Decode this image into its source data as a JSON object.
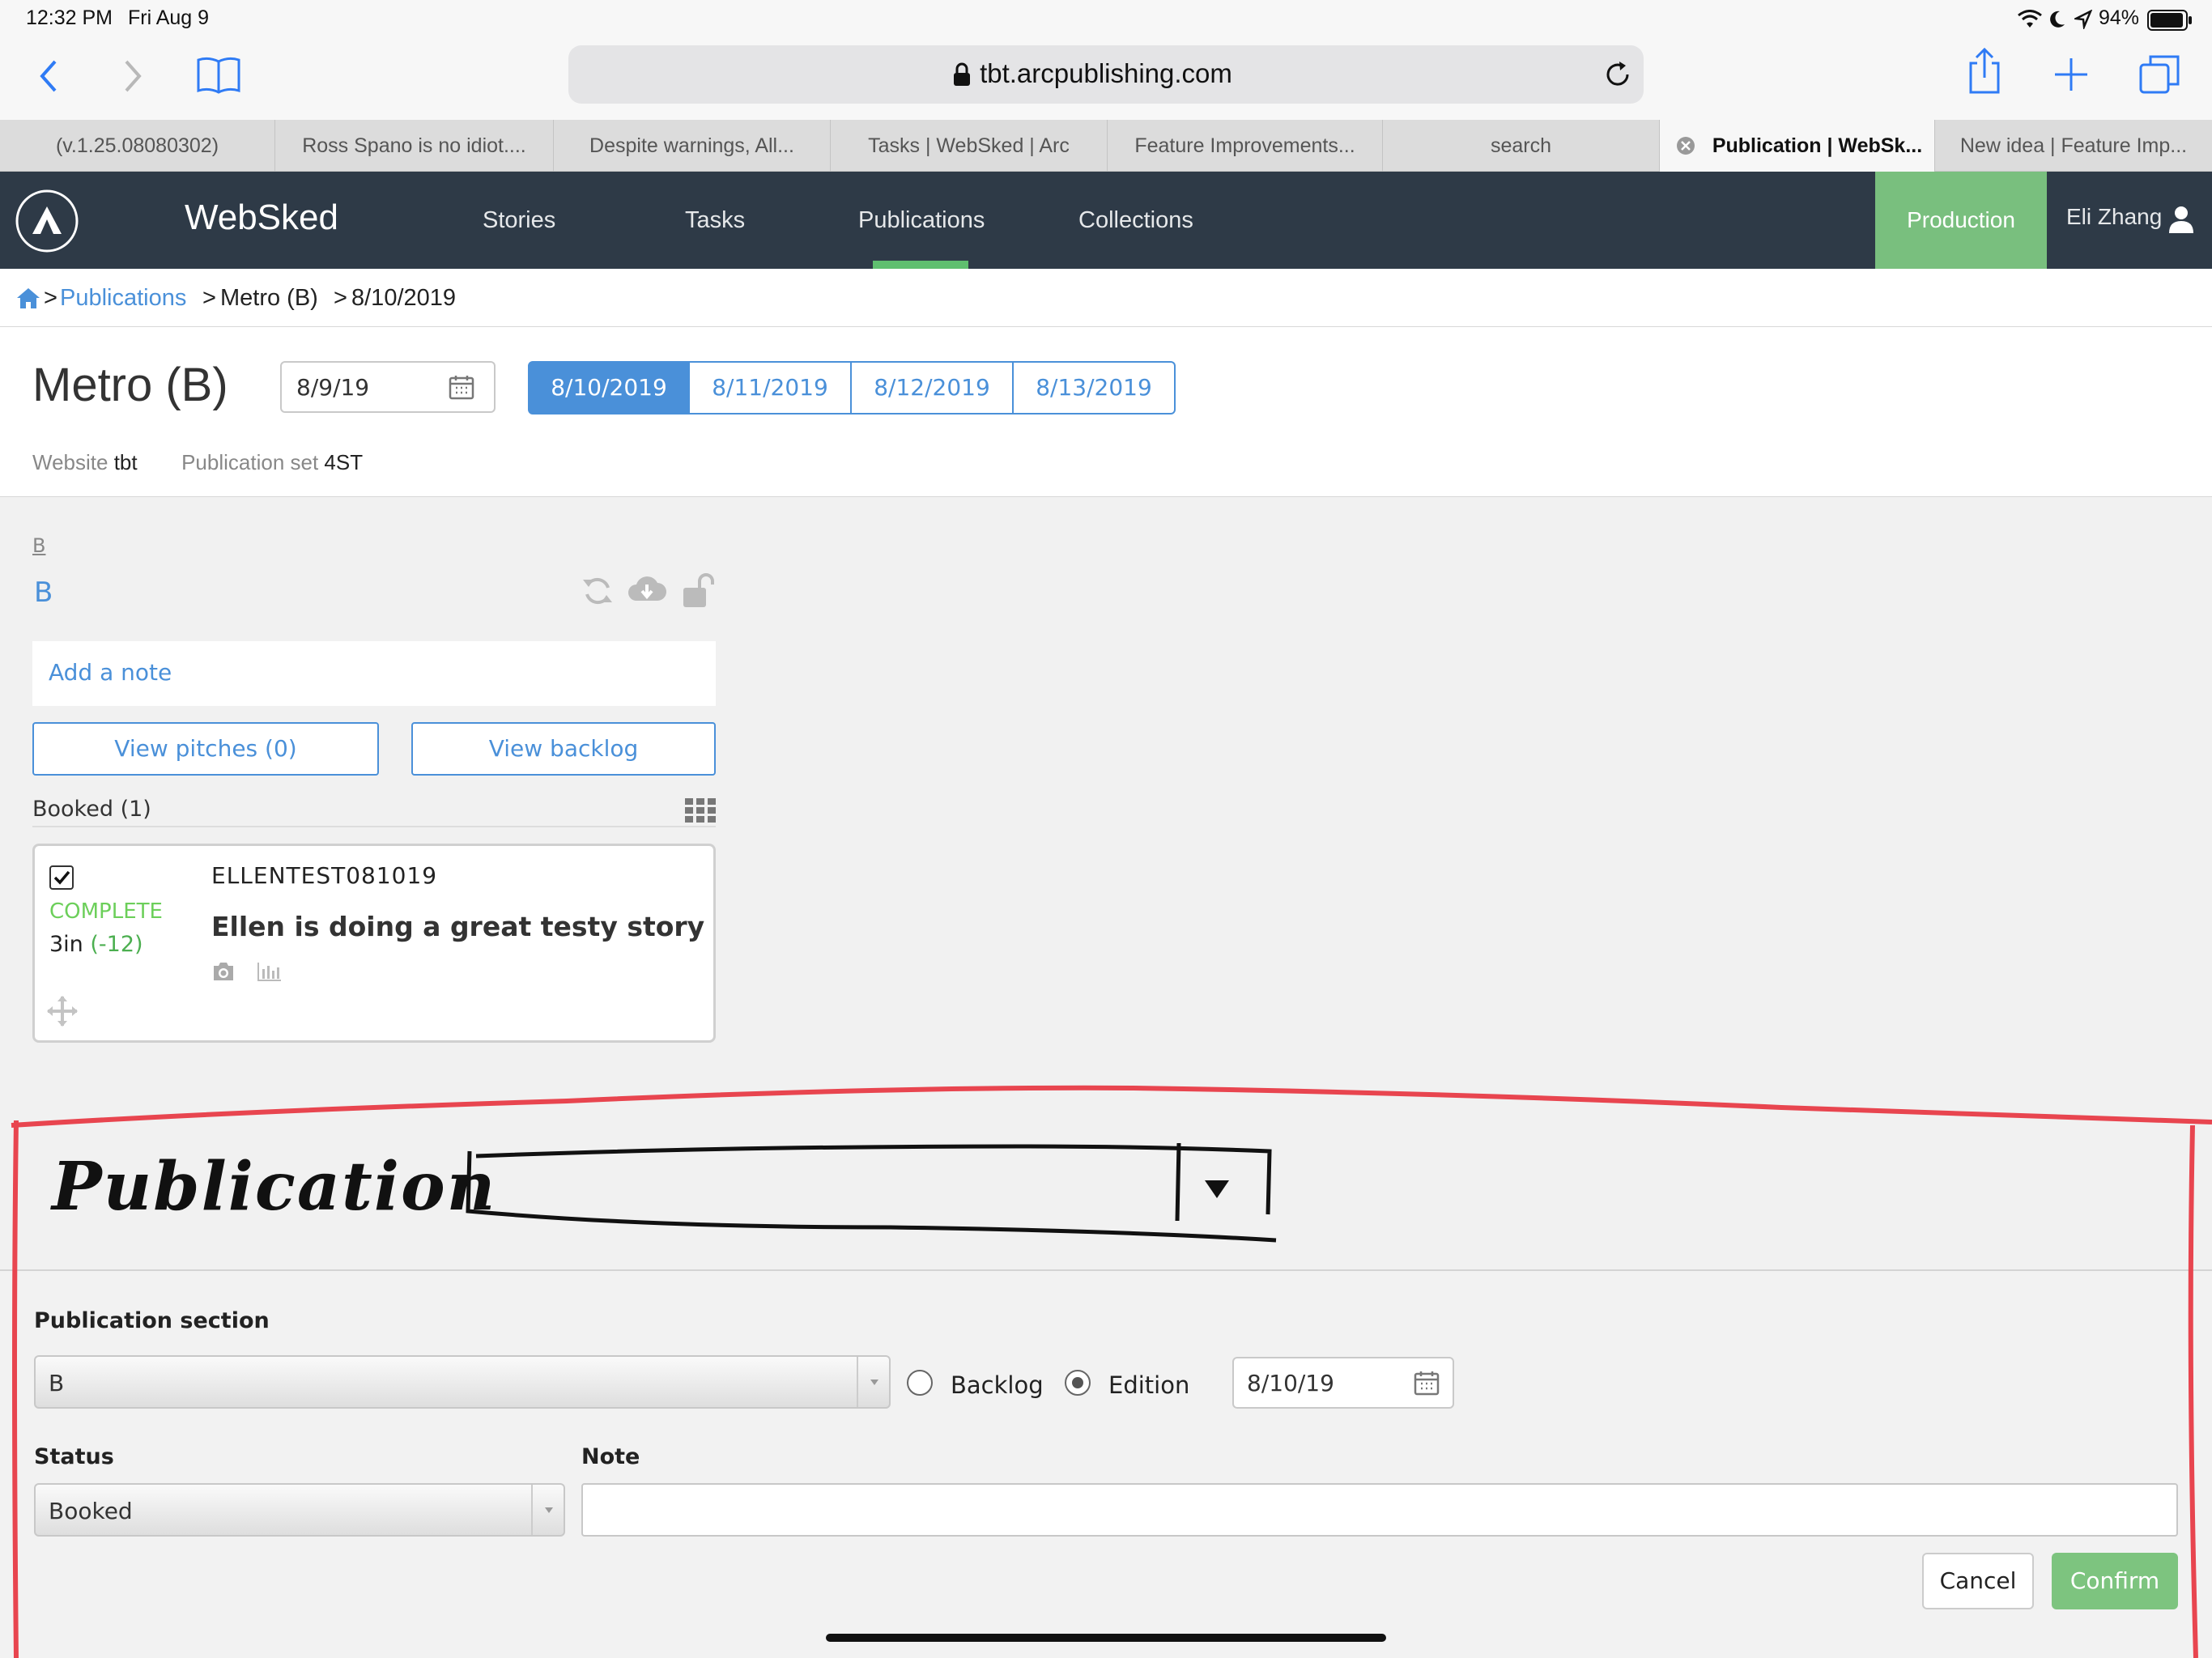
{
  "status_bar": {
    "time": "12:32 PM",
    "date": "Fri Aug 9",
    "battery": "94%"
  },
  "browser": {
    "url": "tbt.arcpublishing.com",
    "tabs": [
      "(v.1.25.08080302)",
      "Ross Spano is no idiot....",
      "Despite warnings, All...",
      "Tasks | WebSked | Arc",
      "Feature Improvements...",
      "search",
      "Publication | WebSk...",
      "New idea | Feature Imp..."
    ]
  },
  "app": {
    "brand": "WebSked",
    "nav": [
      "Stories",
      "Tasks",
      "Publications",
      "Collections"
    ],
    "environment": "Production",
    "user": "Eli Zhang"
  },
  "breadcrumb": {
    "publications": "Publications",
    "publication": "Metro (B)",
    "date": "8/10/2019"
  },
  "header": {
    "title": "Metro (B)",
    "date_input": "8/9/19",
    "date_tabs": [
      "8/10/2019",
      "8/11/2019",
      "8/12/2019",
      "8/13/2019"
    ],
    "website_label": "Website",
    "website_value": "tbt",
    "pubset_label": "Publication set",
    "pubset_value": "4ST"
  },
  "section": {
    "small_link": "B",
    "name": "B",
    "add_note": "Add a note",
    "view_pitches": "View pitches  (0)",
    "view_backlog": "View backlog",
    "booked_label": "Booked (1)"
  },
  "story": {
    "slug": "ELLENTEST081019",
    "status": "COMPLETE",
    "size": "3in",
    "size_delta": "(-12)",
    "title": "Ellen is doing a great testy story"
  },
  "annotation": {
    "handwritten_label": "Publication"
  },
  "form": {
    "section_label": "Publication section",
    "section_value": "B",
    "backlog_label": "Backlog",
    "edition_label": "Edition",
    "edition_date": "8/10/19",
    "status_label": "Status",
    "status_value": "Booked",
    "note_label": "Note",
    "note_value": "",
    "cancel": "Cancel",
    "confirm": "Confirm"
  },
  "colors": {
    "nav_bg": "#2e3a47",
    "accent_blue": "#4a90d9",
    "production_green": "#79bf7e",
    "annotation_red": "#e8454f"
  }
}
